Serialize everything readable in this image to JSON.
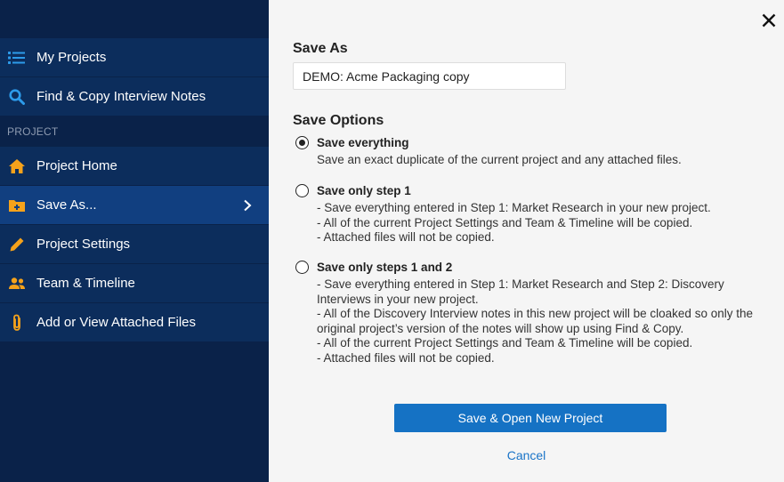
{
  "sidebar": {
    "items_top": [
      {
        "label": "My Projects",
        "icon": "list-icon"
      },
      {
        "label": "Find & Copy Interview Notes",
        "icon": "search-icon"
      }
    ],
    "section_label": "PROJECT",
    "items_project": [
      {
        "label": "Project Home",
        "icon": "home-icon"
      },
      {
        "label": "Save As...",
        "icon": "folder-plus-icon",
        "active": true
      },
      {
        "label": "Project Settings",
        "icon": "pencil-icon"
      },
      {
        "label": "Team & Timeline",
        "icon": "team-icon"
      },
      {
        "label": "Add or View Attached Files",
        "icon": "paperclip-icon"
      }
    ],
    "icon_color": "#f5a21b",
    "search_icon_color": "#2d9bea"
  },
  "panel": {
    "save_as_heading": "Save As",
    "name_value": "DEMO: Acme Packaging copy",
    "save_options_heading": "Save Options",
    "options": [
      {
        "title": "Save everything",
        "selected": true,
        "description": [
          "Save an exact duplicate of the current project and any attached files."
        ]
      },
      {
        "title": "Save only step 1",
        "selected": false,
        "description": [
          "- Save everything entered in Step 1: Market Research in your new project.",
          "- All of the current Project Settings and Team & Timeline will be copied.",
          "- Attached files will not be copied."
        ]
      },
      {
        "title": "Save only steps 1 and 2",
        "selected": false,
        "description": [
          "- Save everything entered in Step 1: Market Research and Step 2: Discovery Interviews in your new project.",
          "- All of the Discovery Interview notes in this new project will be cloaked so only the original project’s version of the notes will show up using Find & Copy.",
          "- All of the current Project Settings and Team & Timeline will be copied.",
          "- Attached files will not be copied."
        ]
      }
    ],
    "primary_button": "Save & Open New Project",
    "cancel_link": "Cancel"
  }
}
